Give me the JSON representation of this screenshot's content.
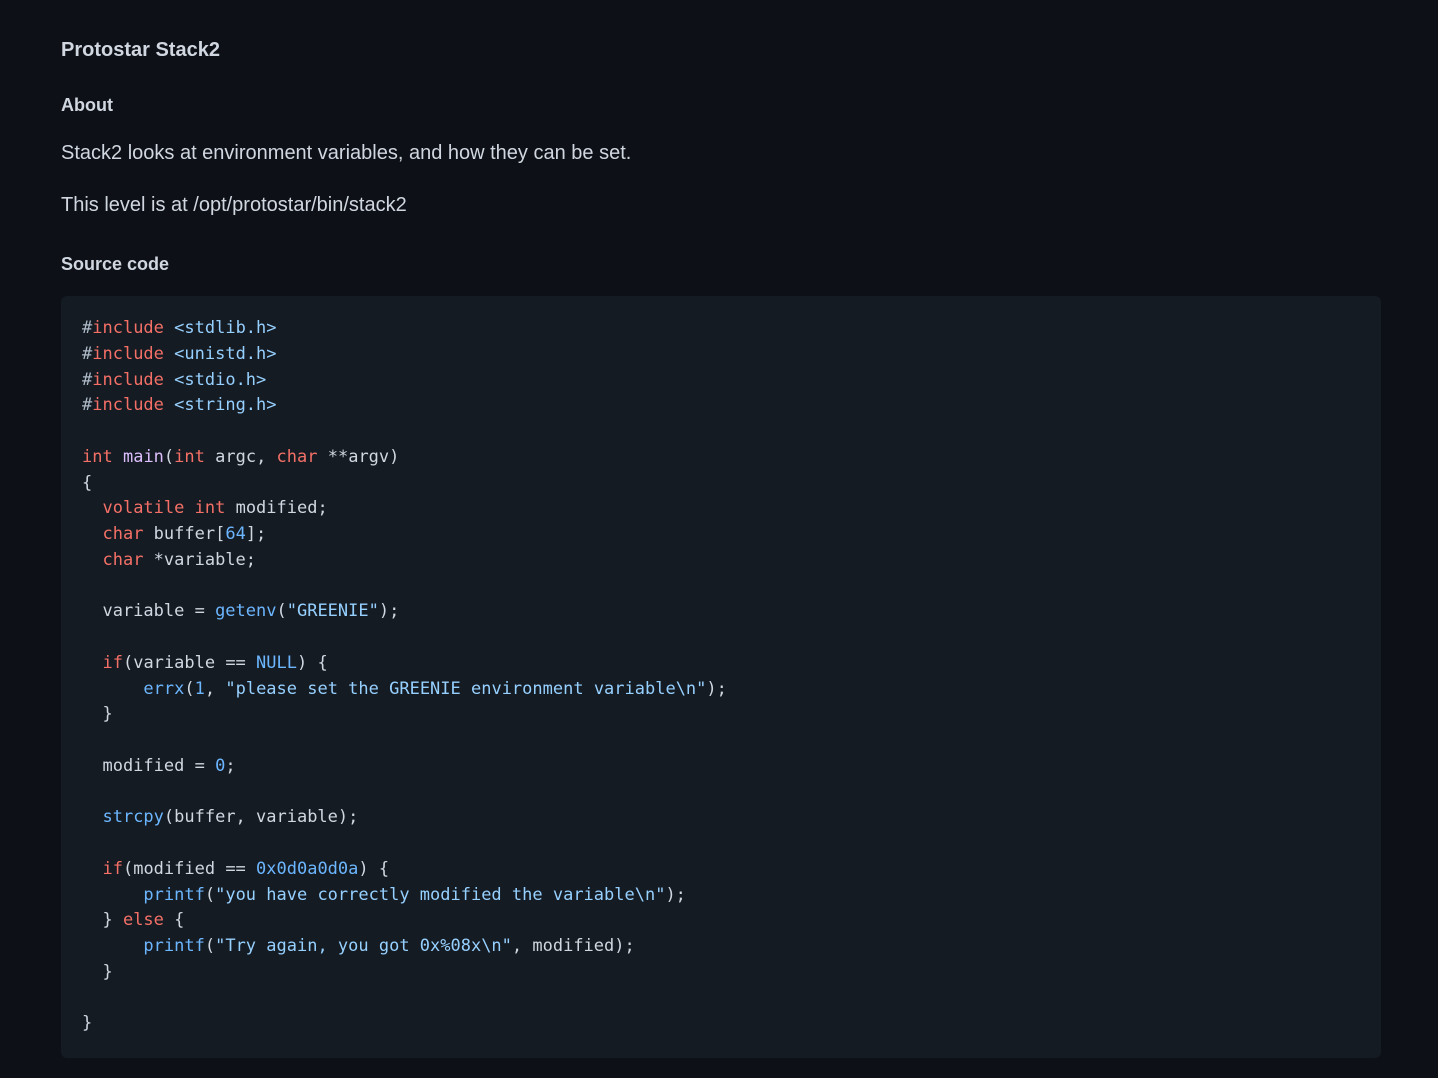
{
  "document": {
    "title": "Protostar Stack2",
    "about_heading": "About",
    "about_paragraphs": [
      "Stack2 looks at environment variables, and how they can be set.",
      "This level is at /opt/protostar/bin/stack2"
    ],
    "source_heading": "Source code"
  },
  "code": {
    "language": "c",
    "colors": {
      "keyword": "#f47067",
      "function": "#6cb6ff",
      "definition": "#dcbdfb",
      "string": "#96d0ff",
      "number": "#6cb6ff",
      "plain": "#d1d7e0",
      "background": "#151b23",
      "page_background": "#0d1117"
    },
    "lines": [
      [
        [
          "pre",
          "#"
        ],
        [
          "kw",
          "include"
        ],
        [
          "plain",
          " "
        ],
        [
          "str",
          "<stdlib.h>"
        ]
      ],
      [
        [
          "pre",
          "#"
        ],
        [
          "kw",
          "include"
        ],
        [
          "plain",
          " "
        ],
        [
          "str",
          "<unistd.h>"
        ]
      ],
      [
        [
          "pre",
          "#"
        ],
        [
          "kw",
          "include"
        ],
        [
          "plain",
          " "
        ],
        [
          "str",
          "<stdio.h>"
        ]
      ],
      [
        [
          "pre",
          "#"
        ],
        [
          "kw",
          "include"
        ],
        [
          "plain",
          " "
        ],
        [
          "str",
          "<string.h>"
        ]
      ],
      [],
      [
        [
          "kw",
          "int"
        ],
        [
          "plain",
          " "
        ],
        [
          "def",
          "main"
        ],
        [
          "plain",
          "("
        ],
        [
          "kw",
          "int"
        ],
        [
          "plain",
          " argc, "
        ],
        [
          "kw",
          "char"
        ],
        [
          "plain",
          " **argv)"
        ]
      ],
      [
        [
          "plain",
          "{"
        ]
      ],
      [
        [
          "plain",
          "  "
        ],
        [
          "kw",
          "volatile"
        ],
        [
          "plain",
          " "
        ],
        [
          "kw",
          "int"
        ],
        [
          "plain",
          " modified;"
        ]
      ],
      [
        [
          "plain",
          "  "
        ],
        [
          "kw",
          "char"
        ],
        [
          "plain",
          " buffer["
        ],
        [
          "num",
          "64"
        ],
        [
          "plain",
          "];"
        ]
      ],
      [
        [
          "plain",
          "  "
        ],
        [
          "kw",
          "char"
        ],
        [
          "plain",
          " *variable;"
        ]
      ],
      [],
      [
        [
          "plain",
          "  variable = "
        ],
        [
          "fn",
          "getenv"
        ],
        [
          "plain",
          "("
        ],
        [
          "str",
          "\"GREENIE\""
        ],
        [
          "plain",
          ");"
        ]
      ],
      [],
      [
        [
          "plain",
          "  "
        ],
        [
          "kw",
          "if"
        ],
        [
          "plain",
          "(variable == "
        ],
        [
          "num",
          "NULL"
        ],
        [
          "plain",
          ") {"
        ]
      ],
      [
        [
          "plain",
          "      "
        ],
        [
          "fn",
          "errx"
        ],
        [
          "plain",
          "("
        ],
        [
          "num",
          "1"
        ],
        [
          "plain",
          ", "
        ],
        [
          "str",
          "\"please set the GREENIE environment variable\\n\""
        ],
        [
          "plain",
          ");"
        ]
      ],
      [
        [
          "plain",
          "  }"
        ]
      ],
      [],
      [
        [
          "plain",
          "  modified = "
        ],
        [
          "num",
          "0"
        ],
        [
          "plain",
          ";"
        ]
      ],
      [],
      [
        [
          "plain",
          "  "
        ],
        [
          "fn",
          "strcpy"
        ],
        [
          "plain",
          "(buffer, variable);"
        ]
      ],
      [],
      [
        [
          "plain",
          "  "
        ],
        [
          "kw",
          "if"
        ],
        [
          "plain",
          "(modified == "
        ],
        [
          "num",
          "0x0d0a0d0a"
        ],
        [
          "plain",
          ") {"
        ]
      ],
      [
        [
          "plain",
          "      "
        ],
        [
          "fn",
          "printf"
        ],
        [
          "plain",
          "("
        ],
        [
          "str",
          "\"you have correctly modified the variable\\n\""
        ],
        [
          "plain",
          ");"
        ]
      ],
      [
        [
          "plain",
          "  } "
        ],
        [
          "kw",
          "else"
        ],
        [
          "plain",
          " {"
        ]
      ],
      [
        [
          "plain",
          "      "
        ],
        [
          "fn",
          "printf"
        ],
        [
          "plain",
          "("
        ],
        [
          "str",
          "\"Try again, you got 0x%08x\\n\""
        ],
        [
          "plain",
          ", modified);"
        ]
      ],
      [
        [
          "plain",
          "  }"
        ]
      ],
      [],
      [
        [
          "plain",
          "}"
        ]
      ]
    ]
  }
}
